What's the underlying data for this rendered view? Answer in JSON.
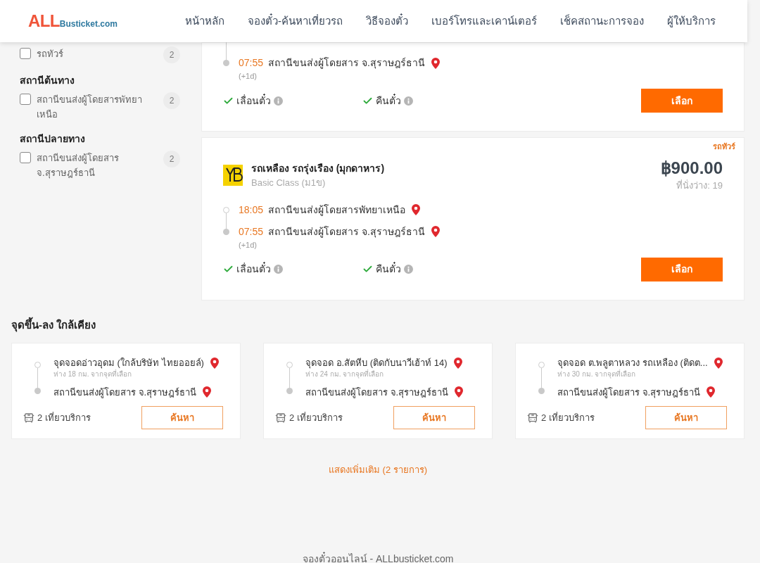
{
  "header": {
    "logo": {
      "accent": "ALL",
      "rest": "Busticket.com"
    },
    "nav": [
      "หน้าหลัก",
      "จองตั๋ว-ค้นหาเที่ยวรถ",
      "วิธีจองตั๋ว",
      "เบอร์โทรและเคาน์เตอร์",
      "เช็คสถานะการจอง",
      "ผู้ให้บริการ"
    ]
  },
  "filter_groups": [
    {
      "items": [
        {
          "label": "รถทัวร์",
          "count": "2",
          "checked": false
        }
      ]
    },
    {
      "title": "สถานีต้นทาง",
      "items": [
        {
          "label": "สถานีขนส่งผู้โดยสารพัทยาเหนือ",
          "count": "2",
          "checked": false
        }
      ]
    },
    {
      "title": "สถานีปลายทาง",
      "items": [
        {
          "label": "สถานีขนส่งผู้โดยสาร จ.สุราษฎร์ธานี",
          "count": "2",
          "checked": false
        }
      ]
    }
  ],
  "trips": [
    {
      "stops": [
        {
          "time": "07:55",
          "station": "สถานีขนส่งผู้โดยสาร จ.สุราษฎร์ธานี",
          "note": "(+1d)"
        }
      ],
      "features": [
        {
          "label": "เลื่อนตั๋ว",
          "available": true
        },
        {
          "label": "คืนตั๋ว",
          "available": true
        }
      ],
      "select_button": "เลือก"
    },
    {
      "tag": "รถทัวร์",
      "operator": "รถเหลือง รถรุ่งเรือง (มุกดาหาร)",
      "class": "Basic Class (ม1ข)",
      "price": "฿900.00",
      "seats": "ที่นั่งว่าง: 19",
      "stops": [
        {
          "time": "18:05",
          "station": "สถานีขนส่งผู้โดยสารพัทยาเหนือ"
        },
        {
          "time": "07:55",
          "station": "สถานีขนส่งผู้โดยสาร จ.สุราษฎร์ธานี",
          "note": "(+1d)"
        }
      ],
      "features": [
        {
          "label": "เลื่อนตั๋ว",
          "available": true
        },
        {
          "label": "คืนตั๋ว",
          "available": true
        }
      ],
      "select_button": "เลือก"
    }
  ],
  "nearby": {
    "title": "จุดขึ้น-ลง ใกล้เคียง",
    "cards": [
      {
        "from": "จุดจอดอ่าวอุดม (ใกล้บริษัท ไทยออยล์)",
        "distance": "ห่าง 18 กม. จากจุดที่เลือก",
        "to": "สถานีขนส่งผู้โดยสาร จ.สุราษฎร์ธานี",
        "trips": "2 เที่ยวบริการ",
        "button": "ค้นหา"
      },
      {
        "from": "จุดจอด อ.สัตหีบ (ติดกับนาวีเฮ้าท์ 14)",
        "distance": "ห่าง 24 กม. จากจุดที่เลือก",
        "to": "สถานีขนส่งผู้โดยสาร จ.สุราษฎร์ธานี",
        "trips": "2 เที่ยวบริการ",
        "button": "ค้นหา"
      },
      {
        "from": "จุดจอด ต.พลูตาหลวง รถเหลือง (ติดต...",
        "distance": "ห่าง 30 กม. จากจุดที่เลือก",
        "to": "สถานีขนส่งผู้โดยสาร จ.สุราษฎร์ธานี",
        "trips": "2 เที่ยวบริการ",
        "button": "ค้นหา"
      }
    ],
    "more_link": "แสดงเพิ่มเติม (2 รายการ)"
  },
  "footer": "จองตั๋วออนไลน์ - ALLbusticket.com"
}
